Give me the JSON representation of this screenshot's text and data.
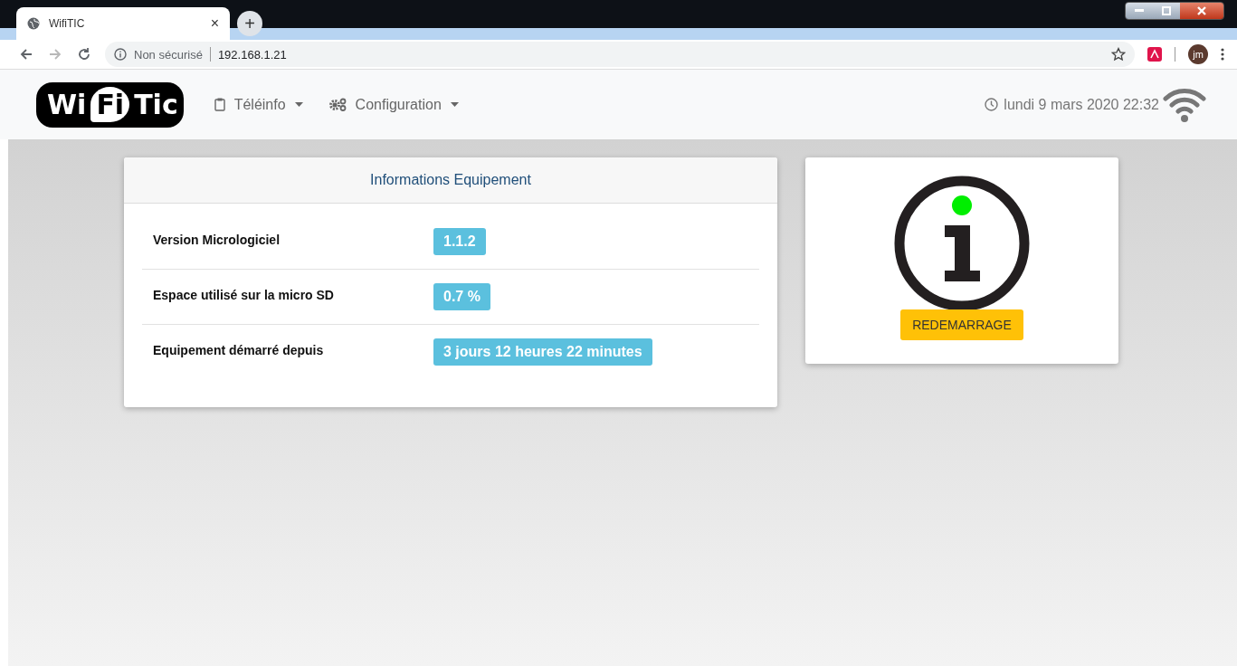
{
  "browser": {
    "tab_title": "WifiTIC",
    "close": "×",
    "new_tab": "+",
    "security": "Non sécurisé",
    "url": "192.168.1.21",
    "avatar": "jm"
  },
  "navbar": {
    "logo": [
      "Wi",
      "Fi",
      "Tic"
    ],
    "menus": [
      {
        "label": "Téléinfo",
        "kind": "clipboard"
      },
      {
        "label": "Configuration",
        "kind": "gears"
      }
    ],
    "datetime": "lundi 9 mars 2020 22:32"
  },
  "info_card": {
    "title": "Informations Equipement",
    "rows": [
      {
        "label": "Version Micrologiciel",
        "value": "1.1.2"
      },
      {
        "label": "Espace utilisé sur la micro SD",
        "value": "0.7 %"
      },
      {
        "label": "Equipement démarré depuis",
        "value": "3 jours 12 heures 22 minutes"
      }
    ]
  },
  "status_card": {
    "online": true,
    "button": "REDEMARRAGE"
  }
}
